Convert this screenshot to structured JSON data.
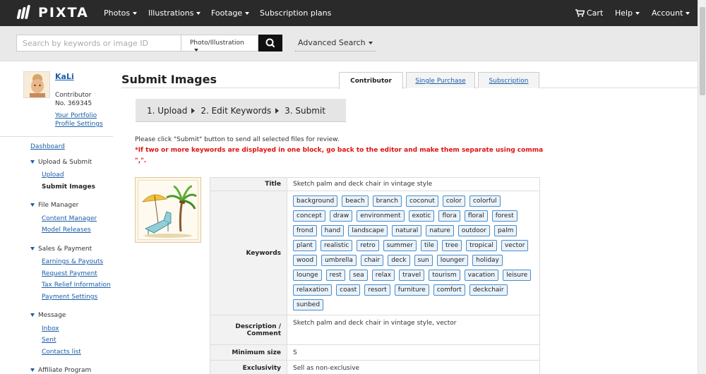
{
  "header": {
    "logo": "PIXTA",
    "nav": [
      "Photos",
      "Illustrations",
      "Footage",
      "Subscription plans"
    ],
    "right_nav": [
      "Cart",
      "Help",
      "Account"
    ]
  },
  "search": {
    "placeholder": "Search by keywords or image ID",
    "type": "Photo/Illustration",
    "advanced": "Advanced Search"
  },
  "user": {
    "name": "KaLi",
    "role": "Contributor",
    "number": "No. 369345",
    "portfolio": "Your Portfolio",
    "profile": "Profile Settings"
  },
  "sidebar": {
    "dashboard": "Dashboard",
    "upload_submit": "Upload & Submit",
    "upload": "Upload",
    "submit_images": "Submit Images",
    "file_manager": "File Manager",
    "content_manager": "Content Manager",
    "model_releases": "Model Releases",
    "sales_payment": "Sales & Payment",
    "earnings": "Earnings & Payouts",
    "request_payment": "Request Payment",
    "tax_relief": "Tax Relief Information",
    "payment_settings": "Payment Settings",
    "message": "Message",
    "inbox": "Inbox",
    "sent": "Sent",
    "contacts": "Contacts list",
    "affiliate": "Affiliate Program"
  },
  "main": {
    "title": "Submit Images",
    "tabs": [
      "Contributor",
      "Single Purchase",
      "Subscription"
    ],
    "steps": [
      "1. Upload",
      "2. Edit Keywords",
      "3. Submit"
    ],
    "notice": "Please click \"Submit\" button to send all selected files for review.",
    "warning": "*If two or more keywords are displayed in one block, go back to the editor and make them separate using comma \",\"."
  },
  "image": {
    "title_label": "Title",
    "title": "Sketch palm and deck chair in vintage style",
    "keywords_label": "Keywords",
    "keywords": [
      "background",
      "beach",
      "branch",
      "coconut",
      "color",
      "colorful",
      "concept",
      "draw",
      "environment",
      "exotic",
      "flora",
      "floral",
      "forest",
      "frond",
      "hand",
      "landscape",
      "natural",
      "nature",
      "outdoor",
      "palm",
      "plant",
      "realistic",
      "retro",
      "summer",
      "tile",
      "tree",
      "tropical",
      "vector",
      "wood",
      "umbrella",
      "chair",
      "deck",
      "sun",
      "lounger",
      "holiday",
      "lounge",
      "rest",
      "sea",
      "relax",
      "travel",
      "tourism",
      "vacation",
      "leisure",
      "relaxation",
      "coast",
      "resort",
      "furniture",
      "comfort",
      "deckchair",
      "sunbed"
    ],
    "description_label": "Description / Comment",
    "description": "Sketch palm and deck chair in vintage style, vector",
    "min_size_label": "Minimum size",
    "min_size": "S",
    "exclusivity_label": "Exclusivity",
    "exclusivity": "Sell as non-exclusive"
  },
  "colors": {
    "topbar": "#2a2a2a",
    "link": "#1a5ea8",
    "warning": "#e01010",
    "keyword_border": "#4a8cc9"
  }
}
